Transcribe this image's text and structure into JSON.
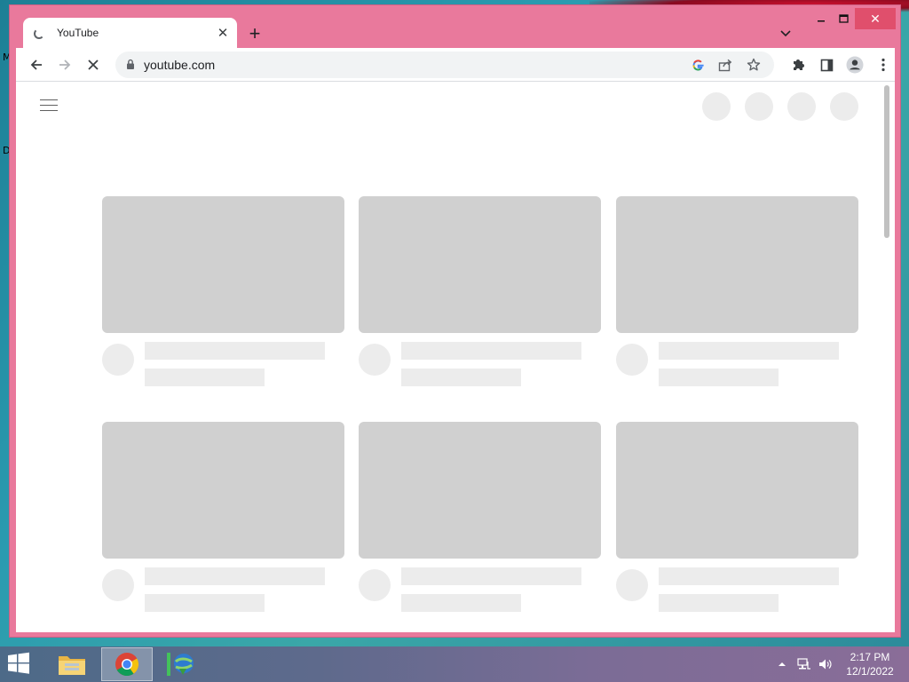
{
  "desktop": {
    "edge_letters": [
      "M",
      "D"
    ]
  },
  "window": {
    "tab": {
      "title": "YouTube",
      "close_glyph": "✕",
      "loading": true
    },
    "new_tab_glyph": "+",
    "controls": {
      "minimize": "–",
      "maximize": "□",
      "close": "✕"
    }
  },
  "toolbar": {
    "url": "youtube.com",
    "icons": [
      "back-arrow-icon",
      "forward-arrow-icon",
      "stop-loading-icon",
      "lock-icon",
      "google-lens-icon",
      "share-icon",
      "bookmark-star-icon",
      "extensions-puzzle-icon",
      "side-panel-icon",
      "profile-icon",
      "menu-kebab-icon"
    ]
  },
  "page": {
    "state": "loading-skeleton",
    "header_icons": [
      "menu-hamburger-icon"
    ],
    "skeleton_rows": 2,
    "skeleton_columns": 3
  },
  "taskbar": {
    "apps": [
      "file-explorer",
      "google-chrome",
      "internet-download-manager"
    ],
    "active_app": "google-chrome",
    "clock": {
      "time": "2:17 PM",
      "date": "12/1/2022"
    }
  },
  "colors": {
    "window_frame": "#e9799c",
    "skeleton_thumb": "#d0d0d0",
    "skeleton_line": "#ececec",
    "close_button": "#e04f6c"
  }
}
